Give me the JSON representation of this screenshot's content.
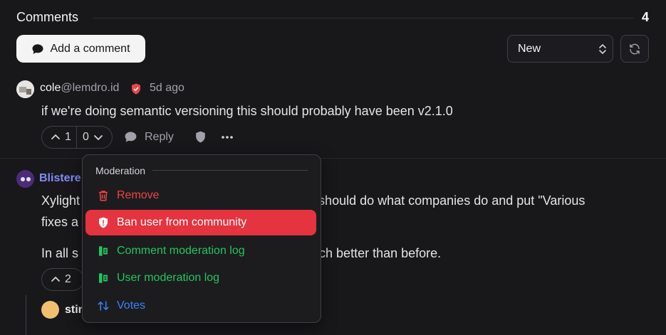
{
  "header": {
    "title": "Comments",
    "count": "4"
  },
  "toolbar": {
    "add_comment": "Add a comment",
    "sort_value": "New"
  },
  "comment1": {
    "user": "cole",
    "instance": "@lemdro.id",
    "time": "5d ago",
    "body": "if we're doing semantic versioning this should probably have been v2.1.0",
    "upvotes": "1",
    "downvotes": "0",
    "reply": "Reply"
  },
  "comment2": {
    "user": "Blistere",
    "body_a": "Xylight",
    "body_a_end": "ou should do what companies do and put \"Various",
    "body_b": "fixes a",
    "body_c": "In all s",
    "body_c_end": "ks much better than before.",
    "upvotes": "2"
  },
  "comment3": {
    "user": "stin"
  },
  "moderation_menu": {
    "title": "Moderation",
    "items": [
      {
        "label": "Remove"
      },
      {
        "label": "Ban user from community"
      },
      {
        "label": "Comment moderation log"
      },
      {
        "label": "User moderation log"
      },
      {
        "label": "Votes"
      }
    ]
  },
  "colors": {
    "danger": "#ef4444",
    "ban_bg": "#e5333f",
    "success": "#22c55e",
    "link": "#3b82f6"
  }
}
